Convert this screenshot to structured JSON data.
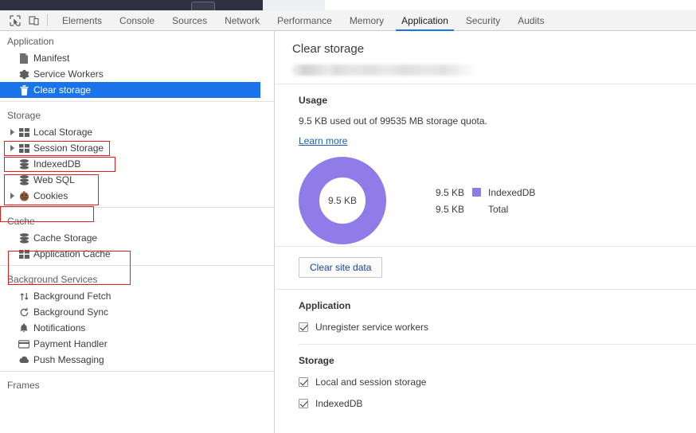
{
  "toolbar": {
    "icons": [
      {
        "name": "inspect-element-icon",
        "title": "Inspect element"
      },
      {
        "name": "device-toolbar-icon",
        "title": "Toggle device toolbar"
      }
    ],
    "tabs": [
      {
        "label": "Elements",
        "active": false
      },
      {
        "label": "Console",
        "active": false
      },
      {
        "label": "Sources",
        "active": false
      },
      {
        "label": "Network",
        "active": false
      },
      {
        "label": "Performance",
        "active": false
      },
      {
        "label": "Memory",
        "active": false
      },
      {
        "label": "Application",
        "active": true
      },
      {
        "label": "Security",
        "active": false
      },
      {
        "label": "Audits",
        "active": false
      }
    ],
    "accent_color": "#1a73e8"
  },
  "sidebar": {
    "sections": [
      {
        "label": "Application",
        "items": [
          {
            "label": "Manifest",
            "icon": "manifest-document-icon",
            "arrow": false,
            "selected": false
          },
          {
            "label": "Service Workers",
            "icon": "gear-icon",
            "arrow": false,
            "selected": false
          },
          {
            "label": "Clear storage",
            "icon": "trash-icon",
            "arrow": false,
            "selected": true
          }
        ]
      },
      {
        "label": "Storage",
        "items": [
          {
            "label": "Local Storage",
            "icon": "table-icon",
            "arrow": true,
            "selected": false
          },
          {
            "label": "Session Storage",
            "icon": "table-icon",
            "arrow": true,
            "selected": false
          },
          {
            "label": "IndexedDB",
            "icon": "database-icon",
            "arrow": false,
            "selected": false
          },
          {
            "label": "Web SQL",
            "icon": "database-icon",
            "arrow": false,
            "selected": false
          },
          {
            "label": "Cookies",
            "icon": "cookie-icon",
            "arrow": true,
            "selected": false
          }
        ]
      },
      {
        "label": "Cache",
        "items": [
          {
            "label": "Cache Storage",
            "icon": "database-icon",
            "arrow": false,
            "selected": false
          },
          {
            "label": "Application Cache",
            "icon": "table-icon",
            "arrow": false,
            "selected": false
          }
        ]
      },
      {
        "label": "Background Services",
        "items": [
          {
            "label": "Background Fetch",
            "icon": "arrows-up-down-icon",
            "arrow": false,
            "selected": false
          },
          {
            "label": "Background Sync",
            "icon": "sync-icon",
            "arrow": false,
            "selected": false
          },
          {
            "label": "Notifications",
            "icon": "bell-icon",
            "arrow": false,
            "selected": false
          },
          {
            "label": "Payment Handler",
            "icon": "credit-card-icon",
            "arrow": false,
            "selected": false
          },
          {
            "label": "Push Messaging",
            "icon": "cloud-icon",
            "arrow": false,
            "selected": false
          }
        ]
      },
      {
        "label": "Frames",
        "items": []
      }
    ],
    "annotation_color": "#e02020",
    "selected_color": "#1a73e8"
  },
  "main": {
    "title": "Clear storage",
    "origin_blurred": true,
    "usage": {
      "heading": "Usage",
      "text": "9.5 KB used out of 99535 MB storage quota.",
      "learn_more": "Learn more"
    },
    "clear_button": "Clear site data",
    "application_group": {
      "title": "Application",
      "options": [
        {
          "label": "Unregister service workers",
          "checked": true
        }
      ]
    },
    "storage_group": {
      "title": "Storage",
      "options": [
        {
          "label": "Local and session storage",
          "checked": true
        },
        {
          "label": "IndexedDB",
          "checked": true
        }
      ]
    }
  },
  "chart_data": {
    "type": "pie",
    "title": "Usage",
    "center_label": "9.5 KB",
    "categories": [
      "IndexedDB"
    ],
    "values": [
      9.5
    ],
    "unit": "KB",
    "colors": [
      "#8f7ce8"
    ],
    "legend": [
      {
        "value": "9.5 KB",
        "name": "IndexedDB",
        "color": "#8f7ce8",
        "swatch": true
      },
      {
        "value": "9.5 KB",
        "name": "Total",
        "color": null,
        "swatch": false
      }
    ],
    "legend_position": "right",
    "total": 9.5,
    "quota_mb": 99535
  }
}
